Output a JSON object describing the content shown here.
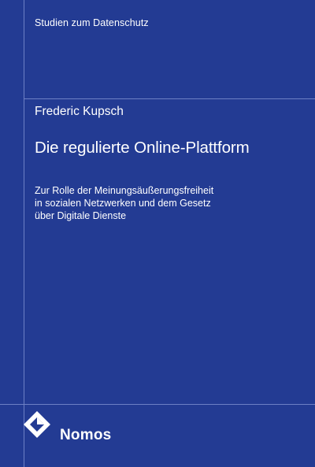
{
  "cover": {
    "series": "Studien zum Datenschutz",
    "author": "Frederic Kupsch",
    "title": "Die regulierte Online-Plattform",
    "subtitle_lines": [
      "Zur Rolle der Meinungsäußerungsfreiheit",
      "in sozialen Netzwerken und dem Gesetz",
      "über Digitale Dienste"
    ],
    "publisher": "Nomos",
    "colors": {
      "background": "#233b93",
      "rule": "#6d80c4",
      "text": "#ffffff"
    },
    "logo_icon": "nomos-diamond-logo-icon"
  }
}
